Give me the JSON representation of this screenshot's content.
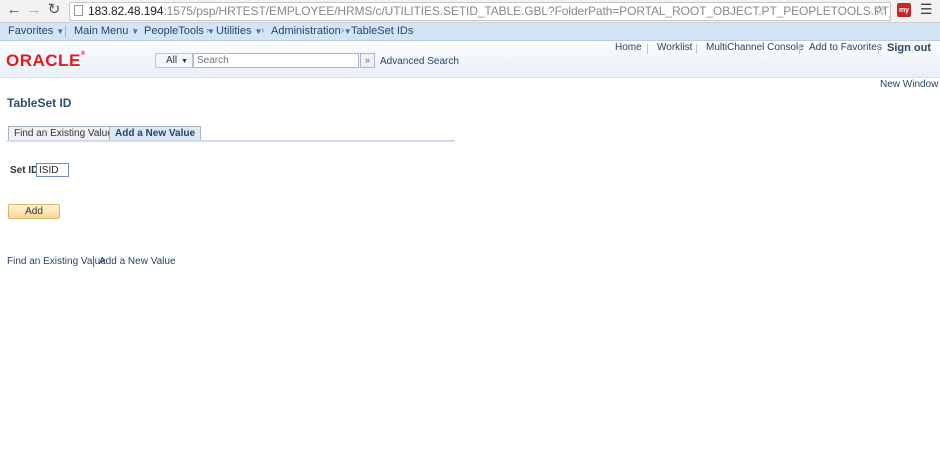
{
  "browser": {
    "url_host": "183.82.48.194",
    "url_rest": ":1575/psp/HRTEST/EMPLOYEE/HRMS/c/UTILITIES.SETID_TABLE.GBL?FolderPath=PORTAL_ROOT_OBJECT.PT_PEOPLETOOLS.PT_UTILITIES.PT_ADMINISTI",
    "ext_icon": "my"
  },
  "navbar": {
    "favorites": "Favorites",
    "main_menu": "Main Menu",
    "peopletools": "PeopleTools",
    "utilities": "Utilities",
    "administration": "Administration",
    "current": "TableSet IDs"
  },
  "header": {
    "logo": "ORACLE",
    "search_scope": "All",
    "search_placeholder": "Search",
    "advanced_search": "Advanced Search",
    "links": {
      "home": "Home",
      "worklist": "Worklist",
      "multichannel": "MultiChannel Console",
      "add_favorites": "Add to Favorites",
      "sign_out": "Sign out"
    }
  },
  "new_window": "New Window",
  "page": {
    "title": "TableSet ID",
    "tabs": [
      {
        "label": "Find an Existing Value",
        "active": false
      },
      {
        "label": "Add a New Value",
        "active": true
      }
    ],
    "setid_label": "Set ID:",
    "setid_value": "ISID",
    "add_button": "Add"
  },
  "bottom_links": {
    "find": "Find an Existing Value",
    "add": "Add a New Value"
  },
  "colors": {
    "brand_red": "#e11b22",
    "link_blue": "#25456a",
    "navbar_bg": "#d3e4f6"
  }
}
